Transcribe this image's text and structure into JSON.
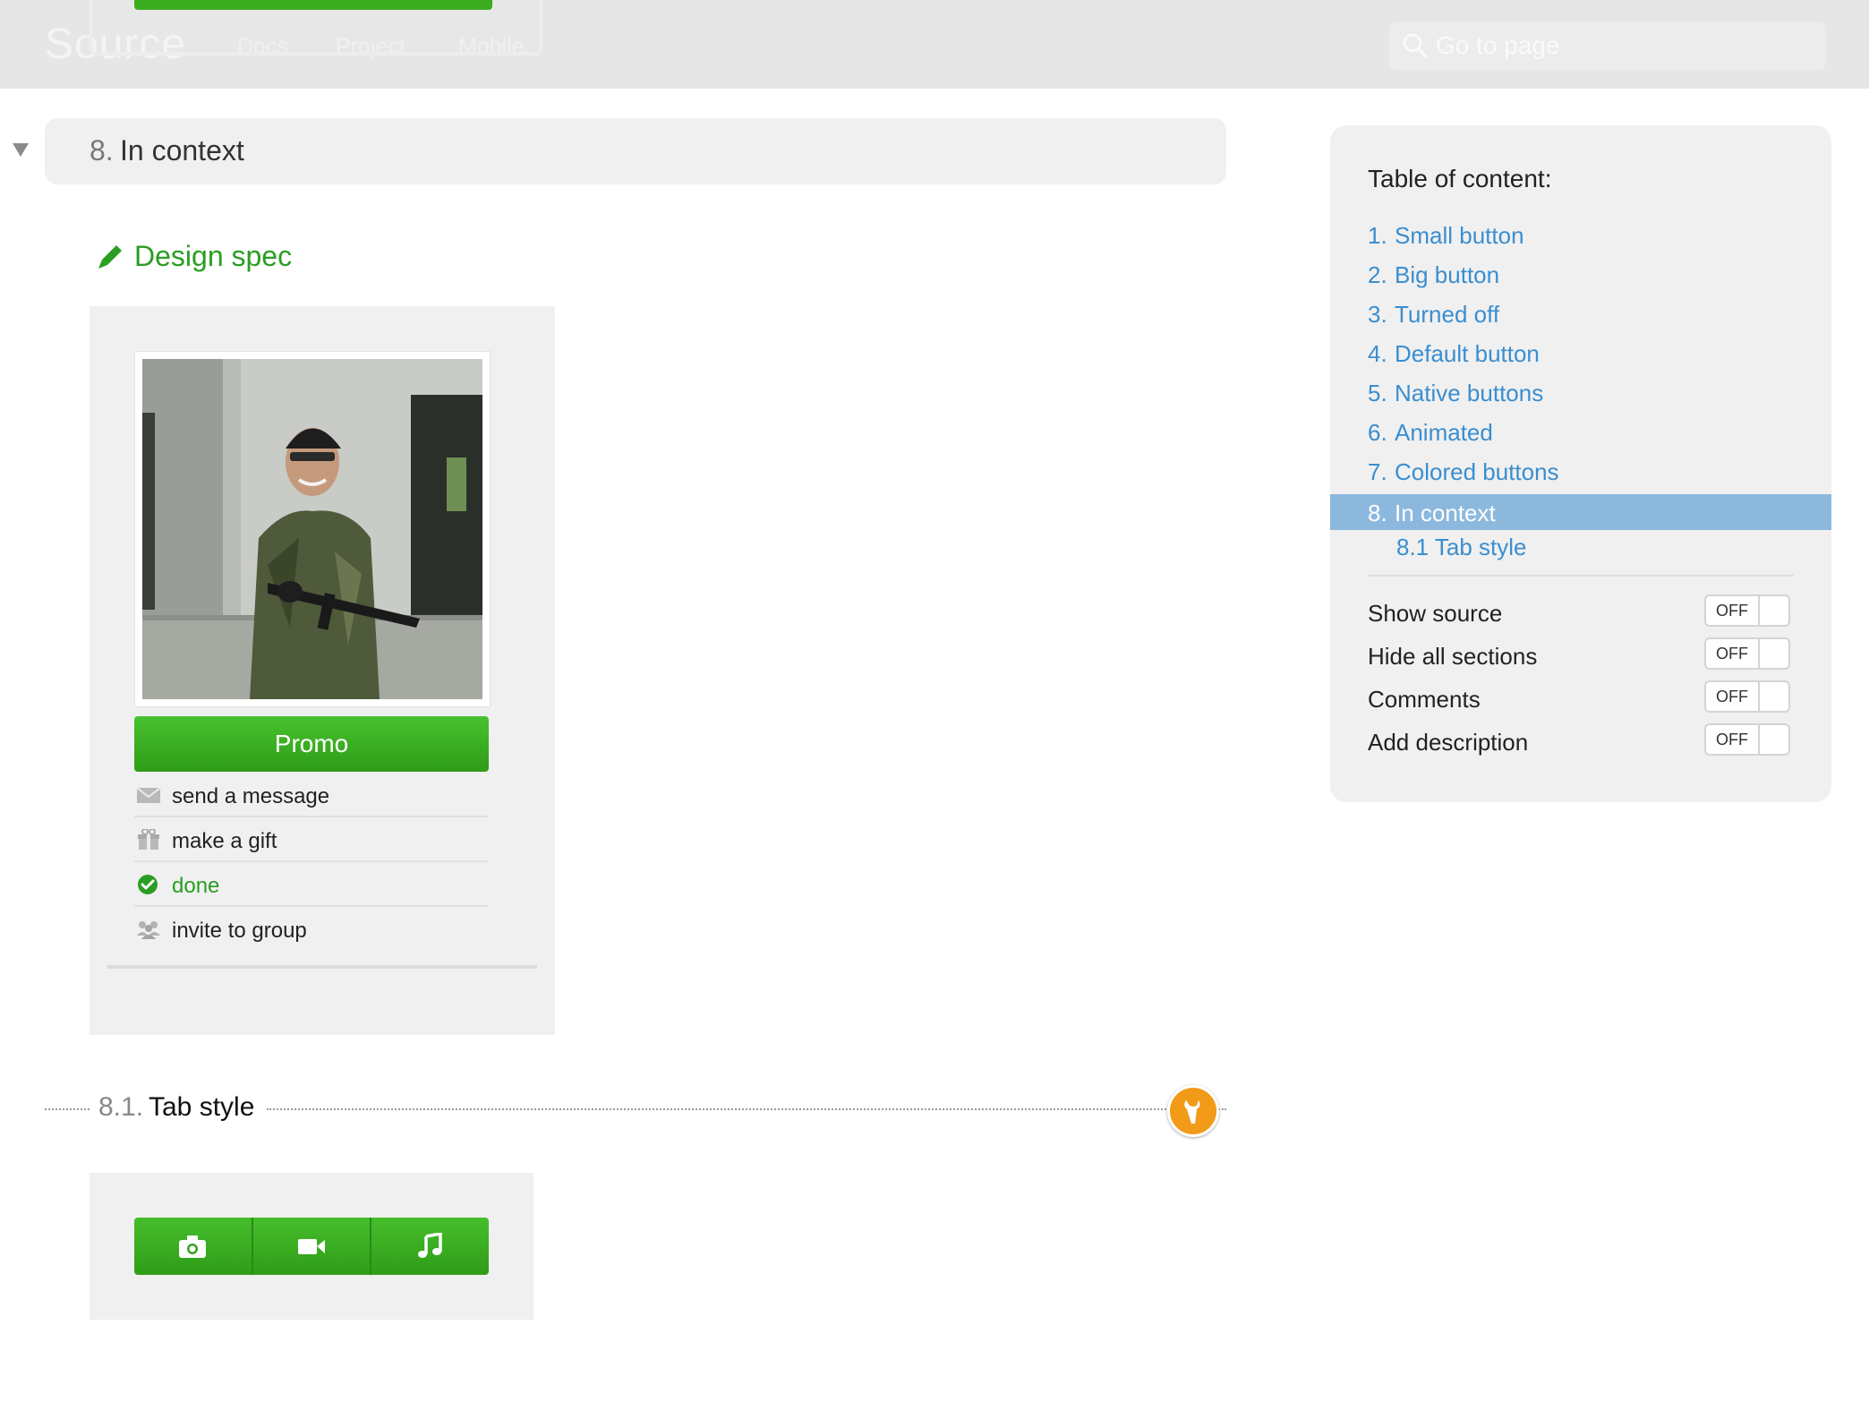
{
  "header": {
    "brand": "Source",
    "nav": [
      "Docs",
      "Project",
      "Mobile"
    ],
    "search_placeholder": "Go to page"
  },
  "section": {
    "number": "8.",
    "title": "In context",
    "design_spec_label": "Design spec"
  },
  "profile_card": {
    "photo_icon": "portrait-photo",
    "promo_label": "Promo",
    "actions": [
      {
        "icon": "envelope-icon",
        "label": "send a message"
      },
      {
        "icon": "gift-icon",
        "label": "make a gift"
      },
      {
        "icon": "check-circle-icon",
        "label": "done"
      },
      {
        "icon": "group-icon",
        "label": "invite to group"
      }
    ]
  },
  "subsection": {
    "number": "8.1.",
    "title": "Tab style",
    "tabs": [
      "camera-icon",
      "video-icon",
      "music-icon"
    ]
  },
  "sidebar": {
    "toc_title": "Table of content:",
    "items": [
      {
        "num": "1.",
        "label": "Small button"
      },
      {
        "num": "2.",
        "label": "Big button"
      },
      {
        "num": "3.",
        "label": "Turned off"
      },
      {
        "num": "4.",
        "label": "Default button"
      },
      {
        "num": "5.",
        "label": "Native buttons"
      },
      {
        "num": "6.",
        "label": "Animated"
      },
      {
        "num": "7.",
        "label": "Colored buttons"
      },
      {
        "num": "8.",
        "label": "In context"
      }
    ],
    "active_item": "8. In context",
    "subitem": "8.1 Tab style",
    "options": [
      {
        "label": "Show source",
        "state": "OFF"
      },
      {
        "label": "Hide all sections",
        "state": "OFF"
      },
      {
        "label": "Comments",
        "state": "OFF"
      },
      {
        "label": "Add description",
        "state": "OFF"
      }
    ]
  },
  "colors": {
    "accent_green": "#2a9e22",
    "link_blue": "#3a8ed0",
    "active_highlight": "#8cb8de",
    "edit_badge": "#f29b18"
  }
}
